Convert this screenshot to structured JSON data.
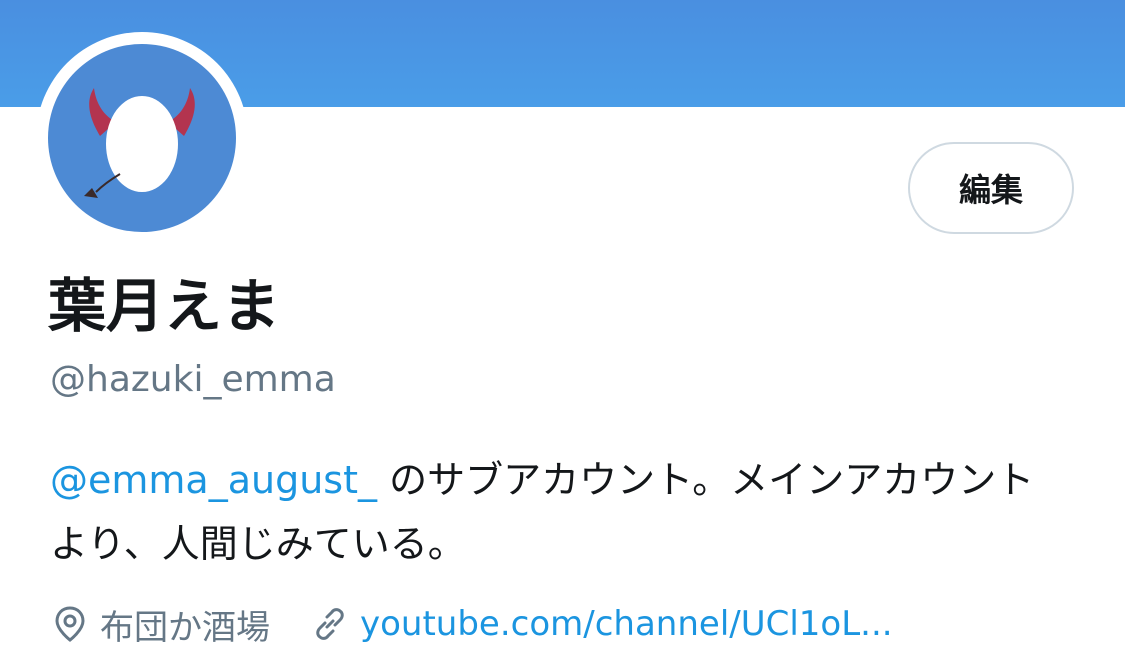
{
  "profile": {
    "display_name": "葉月えま",
    "handle": "@hazuki_emma",
    "edit_label": "編集",
    "bio": {
      "mention": "@emma_august_",
      "text": " のサブアカウント。メインアカウントより、人間じみている。"
    },
    "location": "布団か酒場",
    "url": "youtube.com/channel/UCl1oL..."
  },
  "icons": {
    "location": "location-pin-icon",
    "link": "link-icon",
    "avatar": "default-egg-avatar-with-devil-horns-and-tail"
  },
  "colors": {
    "banner": "#4a9be6",
    "avatar_bg": "#4d8ad4",
    "link": "#1b95e0",
    "secondary_text": "#657786",
    "horns": "#b3344f"
  }
}
